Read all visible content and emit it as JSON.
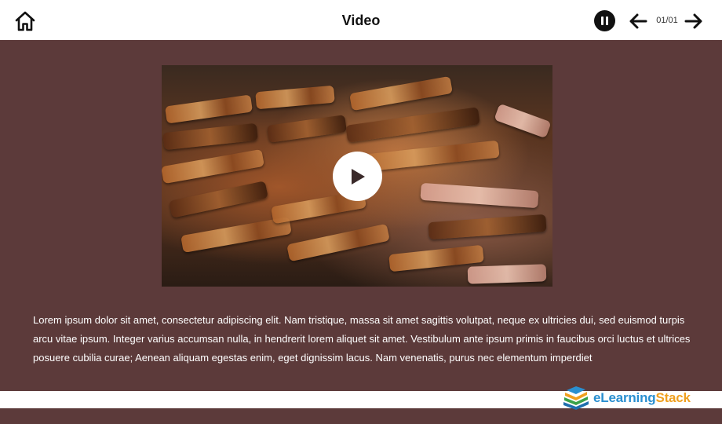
{
  "header": {
    "title": "Video",
    "page_counter": "01/01",
    "icons": {
      "home": "home-icon",
      "pause": "pause-icon",
      "prev": "arrow-left-icon",
      "next": "arrow-right-icon"
    }
  },
  "video": {
    "play_icon": "play-icon"
  },
  "content": {
    "paragraph": "Lorem ipsum dolor sit amet, consectetur adipiscing elit. Nam tristique, massa sit amet sagittis volutpat, neque ex ultricies dui, sed euismod turpis arcu vitae ipsum. Integer varius accumsan nulla, in hendrerit lorem aliquet sit amet. Vestibulum ante ipsum primis in faucibus orci luctus et ultrices posuere cubilia curae; Aenean aliquam egestas enim, eget dignissim lacus. Nam venenatis, purus nec elementum imperdiet"
  },
  "footer": {
    "logo_part1": "eLearning",
    "logo_part2": "Stack"
  },
  "colors": {
    "background": "#5c3a3a",
    "bar": "#ffffff",
    "logo_blue": "#2a8fd0",
    "logo_orange": "#f0a020"
  }
}
